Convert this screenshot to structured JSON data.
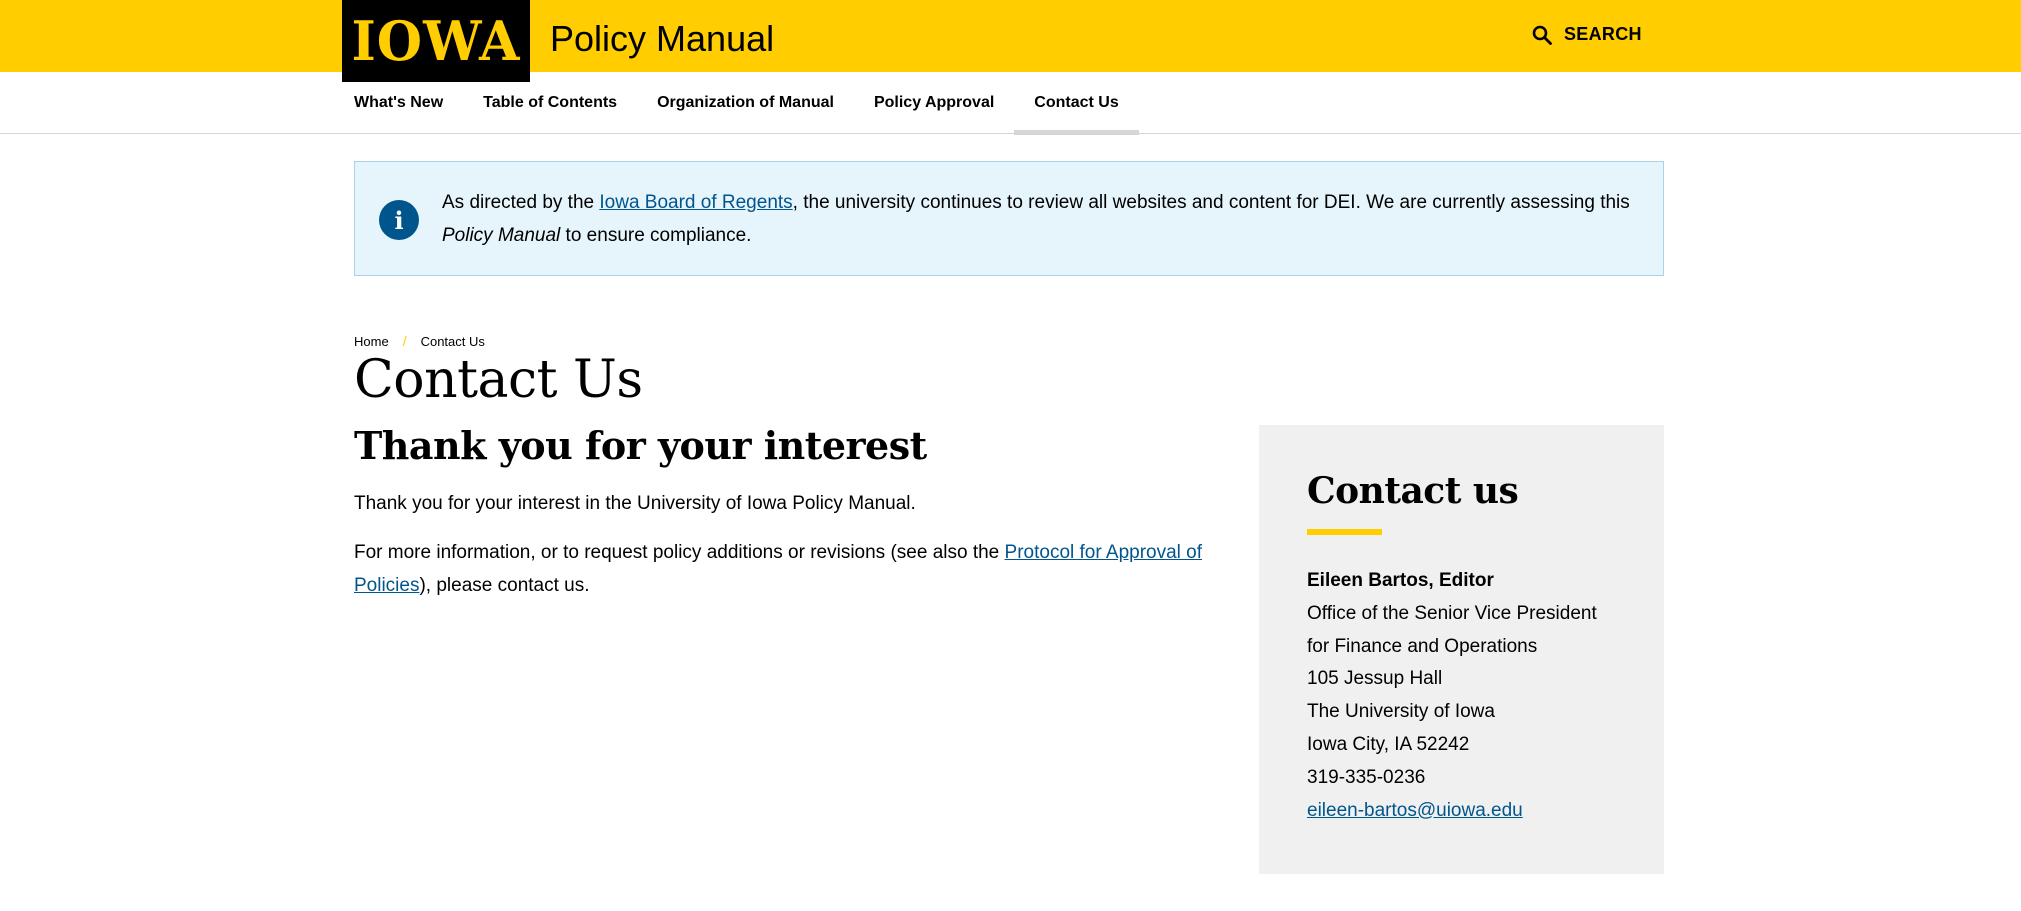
{
  "header": {
    "logo_text": "IOWA",
    "site_title": "Policy Manual",
    "search_label": "SEARCH",
    "brand_color": "#FFCD00"
  },
  "nav": {
    "items": [
      {
        "label": "What's New"
      },
      {
        "label": "Table of Contents"
      },
      {
        "label": "Organization of Manual"
      },
      {
        "label": "Policy Approval"
      },
      {
        "label": "Contact Us",
        "active": true
      }
    ]
  },
  "alert": {
    "icon": "info-icon",
    "text_before_link": "As directed by the ",
    "link_text": "Iowa Board of Regents",
    "text_after_link": ", the university continues to review all websites and content for DEI. We are currently assessing this ",
    "emphasis": "Policy Manual",
    "text_end": " to ensure compliance."
  },
  "breadcrumb": {
    "home": "Home",
    "separator": "/",
    "current": "Contact Us"
  },
  "main": {
    "page_title": "Contact Us",
    "heading": "Thank you for your interest",
    "paragraph1": "Thank you for your interest in the University of Iowa Policy Manual.",
    "paragraph2_before": "For more information, or to request policy additions or revisions (see also the ",
    "paragraph2_link": "Protocol for Approval of Policies",
    "paragraph2_after": "), please contact us."
  },
  "sidebar": {
    "title": "Contact us",
    "name": "Eileen Bartos, Editor",
    "office_line1": "Office of the Senior Vice President",
    "office_line2": "for Finance and Operations",
    "address1": "105 Jessup Hall",
    "address2": "The University of Iowa",
    "address3": "Iowa City, IA 52242",
    "phone": "319-335-0236",
    "email": "eileen-bartos@uiowa.edu"
  }
}
